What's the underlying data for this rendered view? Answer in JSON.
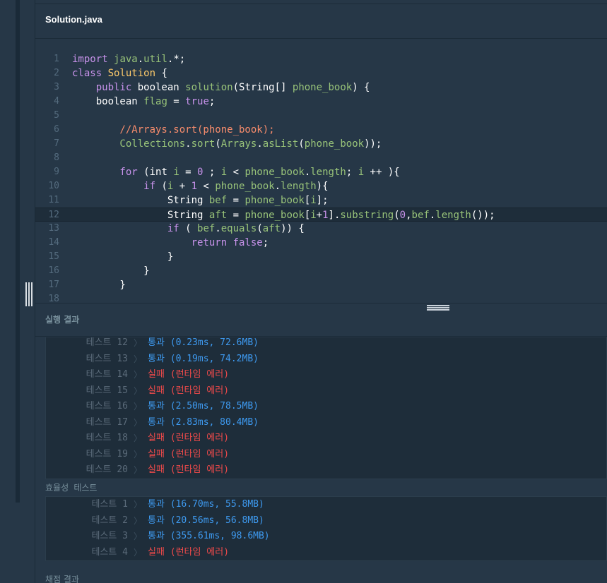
{
  "editor": {
    "file_name": "Solution.java",
    "code": [
      {
        "n": "1",
        "tokens": [
          [
            "import ",
            "#c792ea"
          ],
          [
            "java",
            "#98c379"
          ],
          [
            ".",
            "#ffffff"
          ],
          [
            "util",
            "#98c379"
          ],
          [
            ".*;",
            "#ffffff"
          ]
        ]
      },
      {
        "n": "2",
        "tokens": [
          [
            "class ",
            "#c792ea"
          ],
          [
            "Solution",
            "#ffcb6b"
          ],
          [
            " {",
            "#ffffff"
          ]
        ]
      },
      {
        "n": "3",
        "tokens": [
          [
            "    public ",
            "#c792ea"
          ],
          [
            "boolean ",
            "#ffffff"
          ],
          [
            "solution",
            "#98c379"
          ],
          [
            "(String[] ",
            "#ffffff"
          ],
          [
            "phone_book",
            "#98c379"
          ],
          [
            ") {",
            "#ffffff"
          ]
        ]
      },
      {
        "n": "4",
        "tokens": [
          [
            "    boolean ",
            "#ffffff"
          ],
          [
            "flag",
            "#98c379"
          ],
          [
            " = ",
            "#ffffff"
          ],
          [
            "true",
            "#c792ea"
          ],
          [
            ";",
            "#ffffff"
          ]
        ]
      },
      {
        "n": "5",
        "tokens": []
      },
      {
        "n": "6",
        "tokens": [
          [
            "        //Arrays.sort(phone_book);",
            "#f78c6c"
          ]
        ]
      },
      {
        "n": "7",
        "tokens": [
          [
            "        Collections",
            "#98c379"
          ],
          [
            ".",
            "#ffffff"
          ],
          [
            "sort",
            "#98c379"
          ],
          [
            "(",
            "#ffffff"
          ],
          [
            "Arrays",
            "#98c379"
          ],
          [
            ".",
            "#ffffff"
          ],
          [
            "asList",
            "#98c379"
          ],
          [
            "(",
            "#ffffff"
          ],
          [
            "phone_book",
            "#98c379"
          ],
          [
            "));",
            "#ffffff"
          ]
        ]
      },
      {
        "n": "8",
        "tokens": []
      },
      {
        "n": "9",
        "tokens": [
          [
            "        for ",
            "#c792ea"
          ],
          [
            "(int ",
            "#ffffff"
          ],
          [
            "i",
            "#98c379"
          ],
          [
            " = ",
            "#ffffff"
          ],
          [
            "0",
            "#c792ea"
          ],
          [
            " ; ",
            "#ffffff"
          ],
          [
            "i",
            "#98c379"
          ],
          [
            " < ",
            "#ffffff"
          ],
          [
            "phone_book",
            "#98c379"
          ],
          [
            ".",
            "#ffffff"
          ],
          [
            "length",
            "#98c379"
          ],
          [
            "; ",
            "#ffffff"
          ],
          [
            "i",
            "#98c379"
          ],
          [
            " ++ ){",
            "#ffffff"
          ]
        ]
      },
      {
        "n": "10",
        "tokens": [
          [
            "            if ",
            "#c792ea"
          ],
          [
            "(",
            "#ffffff"
          ],
          [
            "i",
            "#98c379"
          ],
          [
            " + ",
            "#ffffff"
          ],
          [
            "1",
            "#c792ea"
          ],
          [
            " < ",
            "#ffffff"
          ],
          [
            "phone_book",
            "#98c379"
          ],
          [
            ".",
            "#ffffff"
          ],
          [
            "length",
            "#98c379"
          ],
          [
            "){",
            "#ffffff"
          ]
        ]
      },
      {
        "n": "11",
        "tokens": [
          [
            "                String ",
            "#ffffff"
          ],
          [
            "bef",
            "#98c379"
          ],
          [
            " = ",
            "#ffffff"
          ],
          [
            "phone_book",
            "#98c379"
          ],
          [
            "[",
            "#ffffff"
          ],
          [
            "i",
            "#98c379"
          ],
          [
            "];",
            "#ffffff"
          ]
        ]
      },
      {
        "n": "12",
        "tokens": [
          [
            "                String ",
            "#ffffff"
          ],
          [
            "aft",
            "#98c379"
          ],
          [
            " = ",
            "#ffffff"
          ],
          [
            "phone_book",
            "#98c379"
          ],
          [
            "[",
            "#ffffff"
          ],
          [
            "i",
            "#98c379"
          ],
          [
            "+",
            "#ffffff"
          ],
          [
            "1",
            "#c792ea"
          ],
          [
            "].",
            "#ffffff"
          ],
          [
            "substring",
            "#98c379"
          ],
          [
            "(",
            "#ffffff"
          ],
          [
            "0",
            "#c792ea"
          ],
          [
            ",",
            "#ffffff"
          ],
          [
            "bef",
            "#98c379"
          ],
          [
            ".",
            "#ffffff"
          ],
          [
            "length",
            "#98c379"
          ],
          [
            "());",
            "#ffffff"
          ]
        ]
      },
      {
        "n": "13",
        "tokens": [
          [
            "                if ",
            "#c792ea"
          ],
          [
            "( ",
            "#ffffff"
          ],
          [
            "bef",
            "#98c379"
          ],
          [
            ".",
            "#ffffff"
          ],
          [
            "equals",
            "#98c379"
          ],
          [
            "(",
            "#ffffff"
          ],
          [
            "aft",
            "#98c379"
          ],
          [
            ")) {",
            "#ffffff"
          ]
        ]
      },
      {
        "n": "14",
        "tokens": [
          [
            "                    return ",
            "#c792ea"
          ],
          [
            "false",
            "#c792ea"
          ],
          [
            ";",
            "#ffffff"
          ]
        ]
      },
      {
        "n": "15",
        "tokens": [
          [
            "                }",
            "#ffffff"
          ]
        ]
      },
      {
        "n": "16",
        "tokens": [
          [
            "            }",
            "#ffffff"
          ]
        ]
      },
      {
        "n": "17",
        "tokens": [
          [
            "        }",
            "#ffffff"
          ]
        ]
      },
      {
        "n": "18",
        "tokens": []
      }
    ]
  },
  "results": {
    "title": "실행 결과",
    "accuracy": [
      {
        "name": "테스트 12",
        "result": "통과 (0.23ms, 72.6MB)",
        "status": "pass"
      },
      {
        "name": "테스트 13",
        "result": "통과 (0.19ms, 74.2MB)",
        "status": "pass"
      },
      {
        "name": "테스트 14",
        "result": "실패 (런타임 에러)",
        "status": "fail"
      },
      {
        "name": "테스트 15",
        "result": "실패 (런타임 에러)",
        "status": "fail"
      },
      {
        "name": "테스트 16",
        "result": "통과 (2.50ms, 78.5MB)",
        "status": "pass"
      },
      {
        "name": "테스트 17",
        "result": "통과 (2.83ms, 80.4MB)",
        "status": "pass"
      },
      {
        "name": "테스트 18",
        "result": "실패 (런타임 에러)",
        "status": "fail"
      },
      {
        "name": "테스트 19",
        "result": "실패 (런타임 에러)",
        "status": "fail"
      },
      {
        "name": "테스트 20",
        "result": "실패 (런타임 에러)",
        "status": "fail"
      }
    ],
    "efficiency_label": "효율성  테스트",
    "efficiency": [
      {
        "name": "테스트 1",
        "result": "통과 (16.70ms, 55.8MB)",
        "status": "pass"
      },
      {
        "name": "테스트 2",
        "result": "통과 (20.56ms, 56.8MB)",
        "status": "pass"
      },
      {
        "name": "테스트 3",
        "result": "통과 (355.61ms, 98.6MB)",
        "status": "pass"
      },
      {
        "name": "테스트 4",
        "result": "실패 (런타임 에러)",
        "status": "fail"
      }
    ],
    "bottom_label": "채점 결과",
    "separator_glyph": "〉"
  }
}
